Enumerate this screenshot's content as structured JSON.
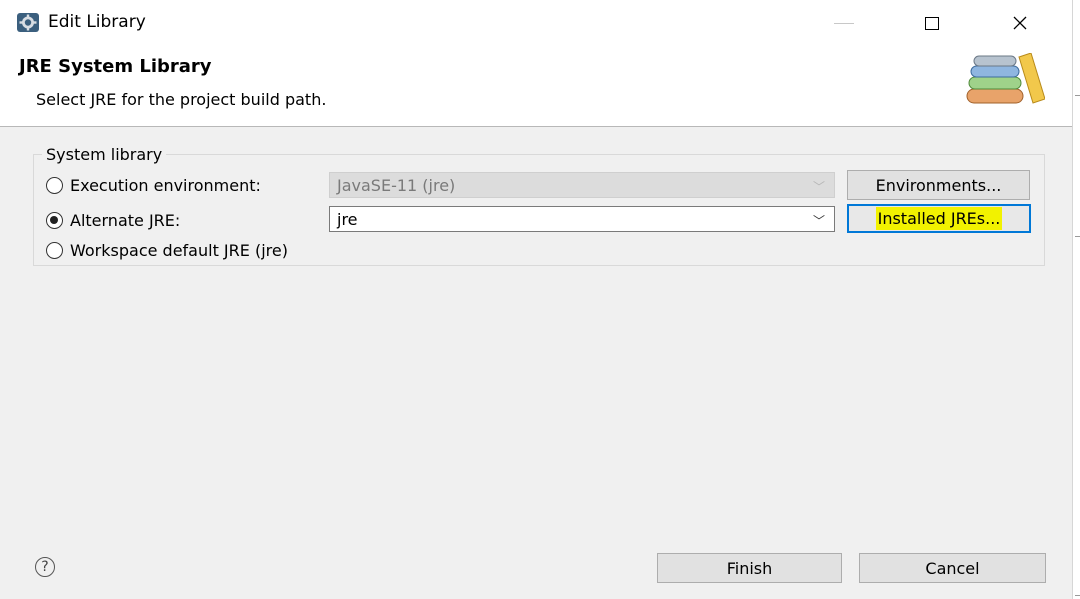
{
  "window": {
    "title": "Edit Library",
    "icon": "gear-icon",
    "controls": {
      "minimize": "minimize-icon",
      "maximize": "maximize-icon",
      "close": "×"
    }
  },
  "header": {
    "title": "JRE System Library",
    "description": "Select JRE for the project build path.",
    "image": "library-books-image"
  },
  "system_library": {
    "group_label": "System library",
    "execution_environment": {
      "label": "Execution environment:",
      "selected": false,
      "value": "JavaSE-11 (jre)",
      "enabled": false,
      "button": "Environments..."
    },
    "alternate_jre": {
      "label": "Alternate JRE:",
      "selected": true,
      "value": "jre",
      "enabled": true,
      "button": "Installed JREs..."
    },
    "workspace_default": {
      "label": "Workspace default JRE (jre)",
      "selected": false
    }
  },
  "footer": {
    "help_icon": "?",
    "finish": "Finish",
    "cancel": "Cancel"
  },
  "colors": {
    "highlight": "#f2f200",
    "focus_border": "#0078d7",
    "dialog_bg": "#f0f0f0"
  }
}
